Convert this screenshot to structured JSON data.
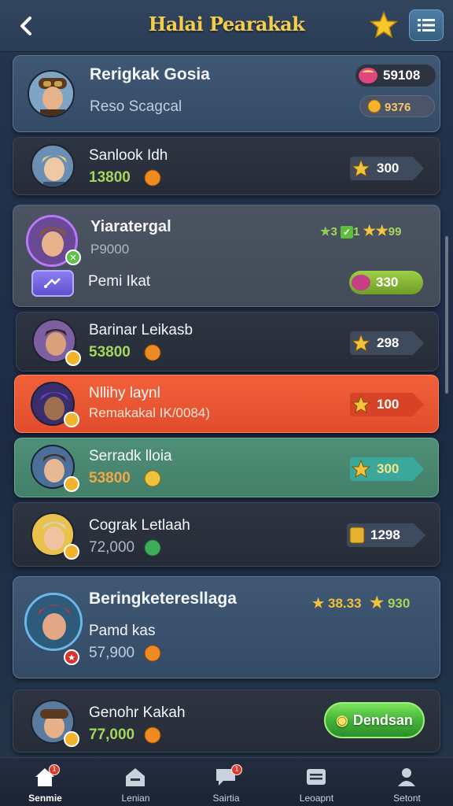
{
  "header": {
    "title": "Halai Pearakak",
    "icons": [
      "back-arrow-icon",
      "star-icon",
      "list-menu-icon"
    ]
  },
  "colors": {
    "accent_gold": "#f5cd4c",
    "orange_highlight": "#e14d2c",
    "green_highlight": "#437f69",
    "cta_green": "#3fb037"
  },
  "profile": {
    "name": "Rerigkak Gosia",
    "subtitle": "Reso Scagcal",
    "gems": "59108",
    "coins": "9376"
  },
  "rows": [
    {
      "name": "Sanlook Idh",
      "score": "13800",
      "rank_value": "300"
    },
    {
      "name": "Yiaratergal",
      "score": "P9000",
      "status": "Pemi Ikat",
      "rating_a": "3",
      "rating_b": "1",
      "rating_c": "99",
      "gem_value": "330"
    },
    {
      "name": "Barinar Leikasb",
      "score": "53800",
      "rank_value": "298"
    },
    {
      "name": "Nllihy laynl",
      "subtitle": "Remakakal IK/0084)",
      "rank_value": "100"
    },
    {
      "name": "Serradk lloia",
      "score": "53800",
      "rank_value": "300"
    },
    {
      "name": "Cograk Letlaah",
      "score": "72,000",
      "rank_value": "1298"
    },
    {
      "name": "Beringketeresllaga",
      "status": "Pamd kas",
      "score": "57,900",
      "stat_a": "38.33",
      "stat_b": "930"
    },
    {
      "name": "Genohr Kakah",
      "score": "77,000",
      "button_label": "Dendsan"
    }
  ],
  "bottom_nav": [
    {
      "label": "Senmie",
      "icon": "home-icon",
      "badge": "1"
    },
    {
      "label": "Lenian",
      "icon": "barn-icon"
    },
    {
      "label": "Sairtia",
      "icon": "chat-icon",
      "badge": "1"
    },
    {
      "label": "Leoapnt",
      "icon": "inbox-icon"
    },
    {
      "label": "Setont",
      "icon": "user-icon"
    }
  ]
}
